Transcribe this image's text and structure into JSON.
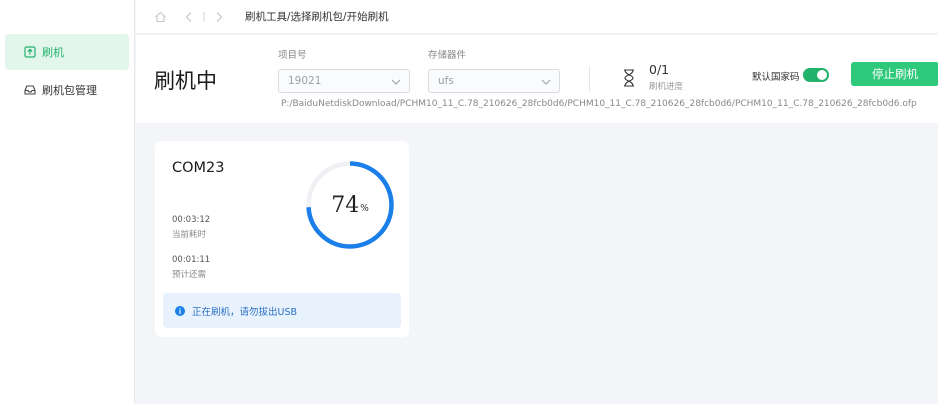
{
  "sidebar": {
    "items": [
      {
        "label": "刷机",
        "icon": "upload-box-icon",
        "active": true
      },
      {
        "label": "刷机包管理",
        "icon": "inbox-icon",
        "active": false
      }
    ]
  },
  "breadcrumb": {
    "text": "刷机工具/选择刷机包/开始刷机"
  },
  "header": {
    "title": "刷机中",
    "project": {
      "label": "项目号",
      "value": "19021"
    },
    "storage": {
      "label": "存储器件",
      "value": "ufs"
    },
    "progress": {
      "value": "0/1",
      "label": "刷机进度"
    },
    "toggle": {
      "label": "默认国家码",
      "on": true
    },
    "stop_button": "停止刷机",
    "path": "P:/BaiduNetdiskDownload/PCHM10_11_C.78_210626_28fcb0d6/PCHM10_11_C.78_210626_28fcb0d6/PCHM10_11_C.78_210626_28fcb0d6.ofp"
  },
  "device": {
    "port": "COM23",
    "elapsed_time": "00:03:12",
    "elapsed_label": "当前耗时",
    "remaining_time": "00:01:11",
    "remaining_label": "预计还需",
    "percent": 74,
    "percent_symbol": "%",
    "notice": "正在刷机，请勿拔出USB"
  },
  "colors": {
    "accent_green": "#2ec97a",
    "ring_blue": "#1a7fe8",
    "notice_bg": "#e8f2fd"
  }
}
